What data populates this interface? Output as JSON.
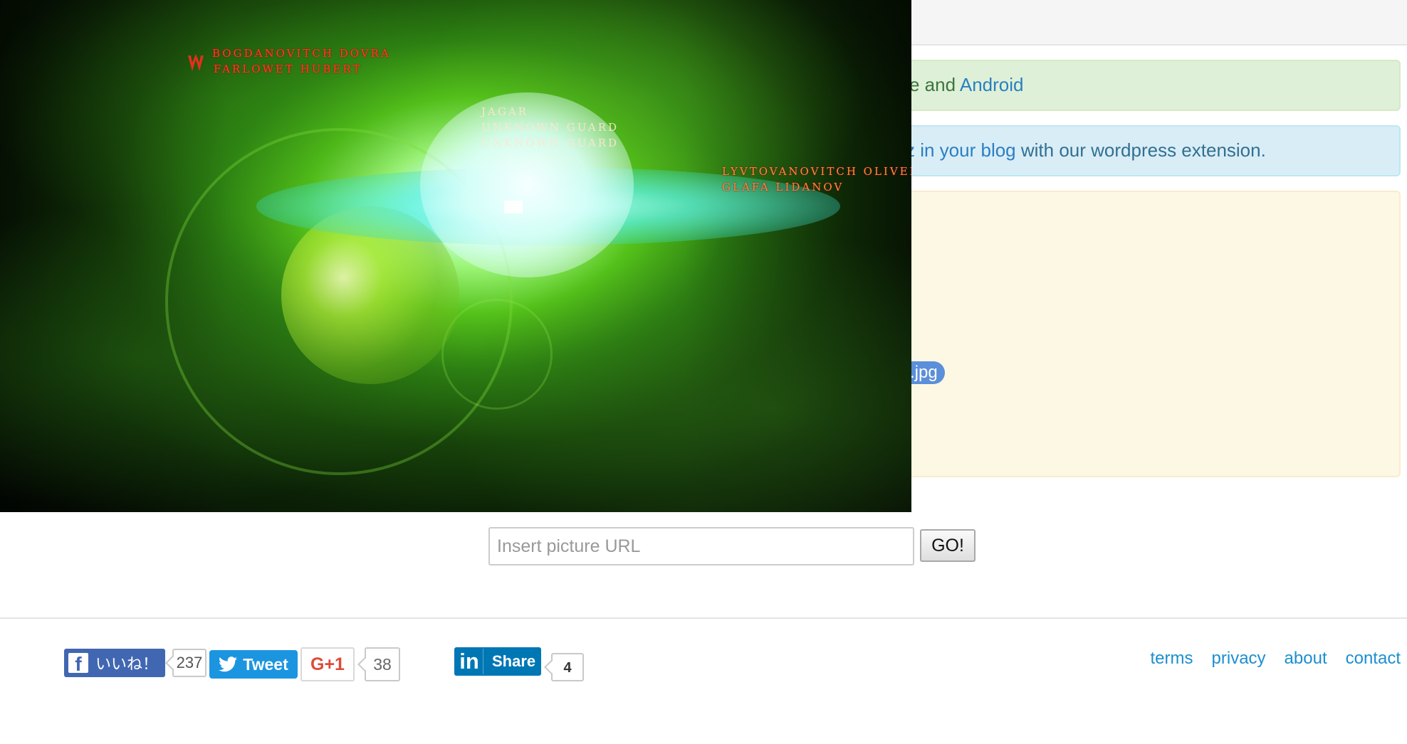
{
  "alerts": {
    "success": {
      "text_pre": "e and ",
      "link": "Android"
    },
    "info": {
      "link": "z in your blog",
      "text_post": " with our wordpress extension."
    },
    "file_name": ".jpg"
  },
  "overlay": {
    "red_credits": [
      "Bogdanovitch Dovra",
      "Farlowet Hubert"
    ],
    "white_credits": [
      "Jagar",
      "Unknown Guard",
      "Unknown Guard"
    ],
    "right_credits": [
      "Lyvtovanovitch Oliver",
      "Glafa Lidanov"
    ]
  },
  "url_form": {
    "placeholder": "Insert picture URL",
    "go_label": "GO!"
  },
  "social": {
    "fb_label": "いいね！",
    "fb_icon": "f",
    "fb_count": "237",
    "tweet_label": "Tweet",
    "gplus_label": "G+1",
    "gplus_count": "38",
    "linkedin_icon": "in",
    "linkedin_label": "Share",
    "linkedin_count": "4"
  },
  "footer": {
    "links": [
      "terms",
      "privacy",
      "about",
      "contact"
    ]
  },
  "colors": {
    "link_blue": "#1c8fcf",
    "facebook": "#4267b2",
    "twitter": "#1b95e0",
    "linkedin": "#0077b5",
    "gplus_red": "#dd4b39"
  }
}
